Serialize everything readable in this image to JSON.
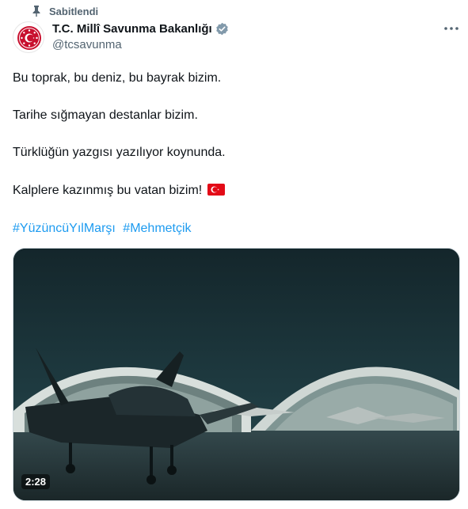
{
  "pinned": {
    "label": "Sabitlendi",
    "icon": "pin-icon"
  },
  "author": {
    "display_name": "T.C. Millî Savunma Bakanlığı",
    "handle": "@tcsavunma",
    "verified_color": "#829aab",
    "avatar": "ministry-emblem"
  },
  "tweet": {
    "lines": [
      "Bu toprak, bu deniz, bu bayrak bizim.",
      "Tarihe sığmayan destanlar bizim.",
      "Türklüğün yazgısı yazılıyor koynunda.",
      "Kalplere kazınmış bu vatan bizim!"
    ],
    "emoji": "turkish-flag-icon",
    "hashtags": [
      "#YüzüncüYılMarşı",
      "#Mehmetçik"
    ]
  },
  "video": {
    "duration": "2:28",
    "description_icon": "video-thumbnail"
  },
  "colors": {
    "text": "#0f1419",
    "secondary": "#536471",
    "link": "#1d9bf0",
    "flag_red": "#e30a17"
  }
}
